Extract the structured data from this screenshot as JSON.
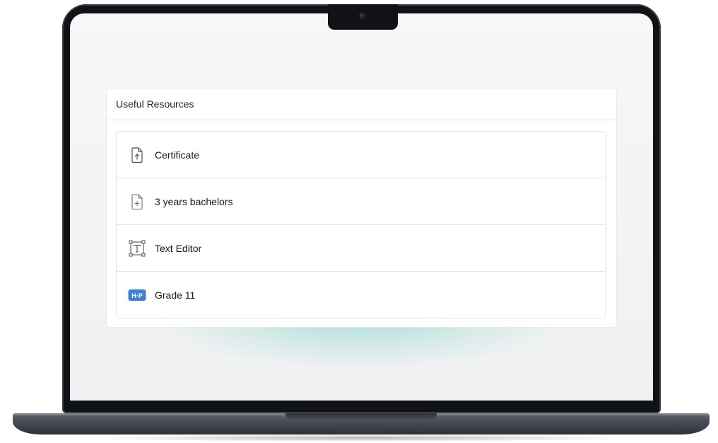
{
  "panel": {
    "title": "Useful Resources",
    "items": [
      {
        "label": "Certificate",
        "icon": "file-upload-icon"
      },
      {
        "label": "3 years bachelors",
        "icon": "file-add-icon"
      },
      {
        "label": "Text Editor",
        "icon": "text-editor-icon"
      },
      {
        "label": "Grade 11",
        "icon": "h5p-icon",
        "badge": "H·P"
      }
    ]
  },
  "colors": {
    "accent_glow": "#8fd4c6",
    "badge_blue": "#3f7fd6",
    "laptop_frame": "#111216"
  }
}
